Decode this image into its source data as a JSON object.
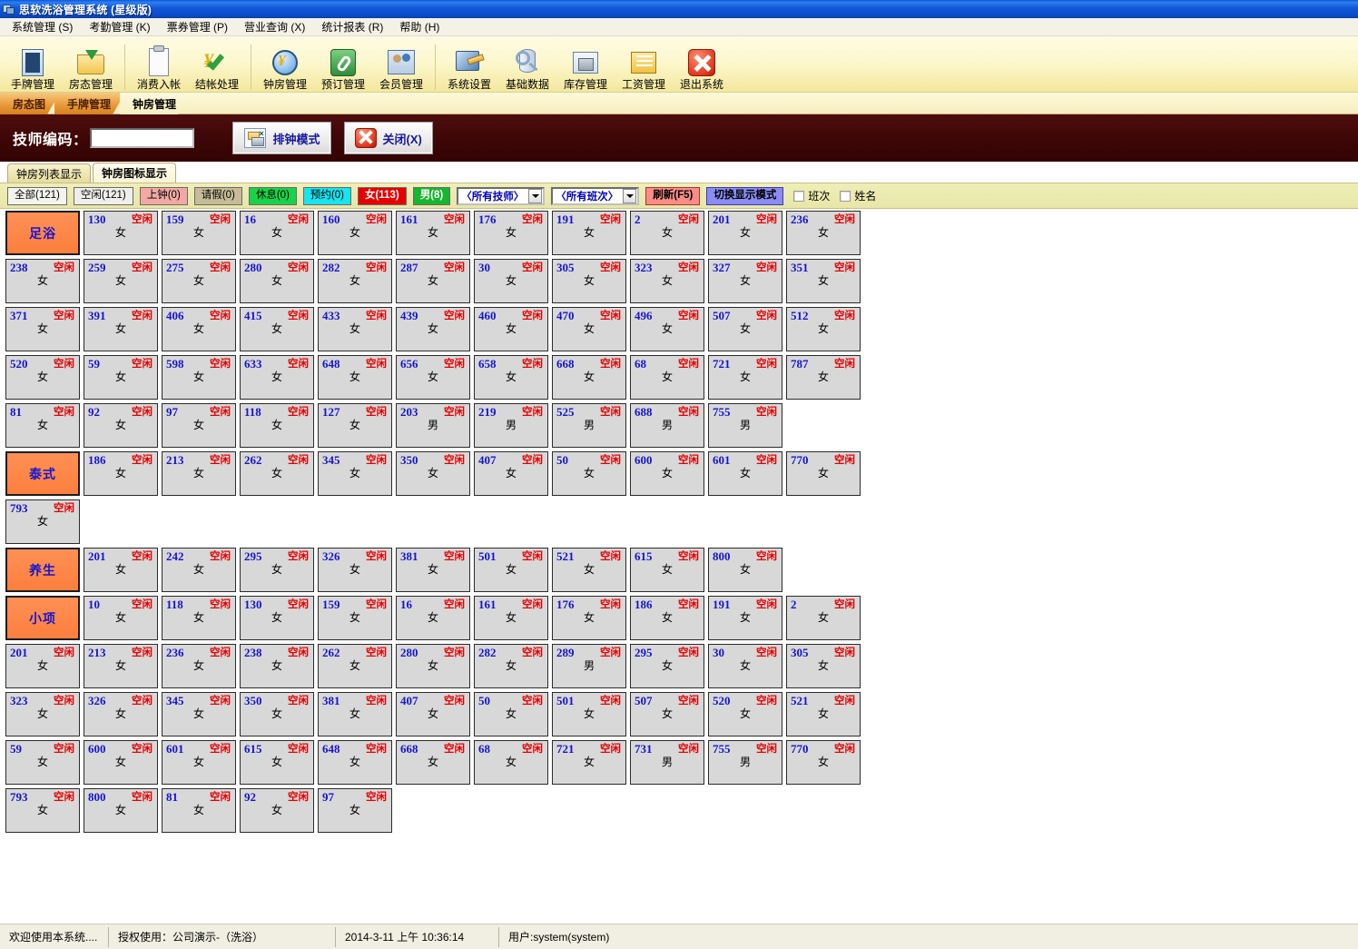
{
  "window": {
    "title": "思软洗浴管理系统 (星级版)"
  },
  "menu": [
    {
      "label": "系统管理 (S)"
    },
    {
      "label": "考勤管理 (K)"
    },
    {
      "label": "票券管理 (P)"
    },
    {
      "label": "营业查询 (X)"
    },
    {
      "label": "统计报表 (R)"
    },
    {
      "label": "帮助 (H)"
    }
  ],
  "toolbar": [
    {
      "label": "手牌管理",
      "icon": "hand-card-icon"
    },
    {
      "label": "房态管理",
      "icon": "room-status-icon"
    },
    {
      "sep": true
    },
    {
      "label": "消费入帐",
      "icon": "consume-entry-icon"
    },
    {
      "label": "结帐处理",
      "icon": "checkout-icon"
    },
    {
      "sep": true
    },
    {
      "label": "钟房管理",
      "icon": "clock-room-icon"
    },
    {
      "label": "预订管理",
      "icon": "reservation-icon"
    },
    {
      "label": "会员管理",
      "icon": "member-icon"
    },
    {
      "sep": true
    },
    {
      "label": "系统设置",
      "icon": "system-settings-icon"
    },
    {
      "label": "基础数据",
      "icon": "base-data-icon"
    },
    {
      "label": "库存管理",
      "icon": "inventory-icon"
    },
    {
      "label": "工资管理",
      "icon": "payroll-icon"
    },
    {
      "label": "退出系统",
      "icon": "exit-icon"
    }
  ],
  "tabs": [
    {
      "label": "房态图",
      "active": false
    },
    {
      "label": "手牌管理",
      "active": false
    },
    {
      "label": "钟房管理",
      "active": true
    }
  ],
  "header": {
    "code_label": "技师编码：",
    "code_value": "",
    "code_placeholder": "",
    "schedule_button": "排钟模式",
    "close_button": "关闭(X)"
  },
  "subtabs": [
    {
      "label": "钟房列表显示",
      "active": false
    },
    {
      "label": "钟房图标显示",
      "active": true
    }
  ],
  "filters": {
    "buttons": [
      {
        "label": "全部(121)",
        "key": "all"
      },
      {
        "label": "空闲(121)",
        "key": "free"
      },
      {
        "label": "上钟(0)",
        "key": "working"
      },
      {
        "label": "请假(0)",
        "key": "leave"
      },
      {
        "label": "休息(0)",
        "key": "rest"
      },
      {
        "label": "预约(0)",
        "key": "booked"
      },
      {
        "label": "女(113)",
        "key": "female"
      },
      {
        "label": "男(8)",
        "key": "male"
      }
    ],
    "select_tech": "〈所有技师〉",
    "select_shift": "〈所有班次〉",
    "refresh_button": "刷新(F5)",
    "mode_button": "切换显示模式",
    "checkbox_shift": "班次",
    "checkbox_name": "姓名",
    "colors": {
      "working": "#f2a9a4",
      "leave": "#c6bc98",
      "rest": "#17d34b",
      "booked": "#16e4f0",
      "female": "#e70000",
      "male": "#17b62f",
      "refresh": "#fa8c86",
      "mode": "#8a8cf4",
      "category": "#fc7f3d"
    }
  },
  "status_free": "空闲",
  "gender_f": "女",
  "gender_m": "男",
  "grid": [
    {
      "cells": [
        {
          "t": "cat",
          "label": "足浴"
        },
        {
          "id": "130",
          "g": "女"
        },
        {
          "id": "159",
          "g": "女"
        },
        {
          "id": "16",
          "g": "女"
        },
        {
          "id": "160",
          "g": "女"
        },
        {
          "id": "161",
          "g": "女"
        },
        {
          "id": "176",
          "g": "女"
        },
        {
          "id": "191",
          "g": "女"
        },
        {
          "id": "2",
          "g": "女"
        },
        {
          "id": "201",
          "g": "女"
        },
        {
          "id": "236",
          "g": "女"
        }
      ]
    },
    {
      "cells": [
        {
          "id": "238",
          "g": "女"
        },
        {
          "id": "259",
          "g": "女"
        },
        {
          "id": "275",
          "g": "女"
        },
        {
          "id": "280",
          "g": "女"
        },
        {
          "id": "282",
          "g": "女"
        },
        {
          "id": "287",
          "g": "女"
        },
        {
          "id": "30",
          "g": "女"
        },
        {
          "id": "305",
          "g": "女"
        },
        {
          "id": "323",
          "g": "女"
        },
        {
          "id": "327",
          "g": "女"
        },
        {
          "id": "351",
          "g": "女"
        }
      ]
    },
    {
      "cells": [
        {
          "id": "371",
          "g": "女"
        },
        {
          "id": "391",
          "g": "女"
        },
        {
          "id": "406",
          "g": "女"
        },
        {
          "id": "415",
          "g": "女"
        },
        {
          "id": "433",
          "g": "女"
        },
        {
          "id": "439",
          "g": "女"
        },
        {
          "id": "460",
          "g": "女"
        },
        {
          "id": "470",
          "g": "女"
        },
        {
          "id": "496",
          "g": "女"
        },
        {
          "id": "507",
          "g": "女"
        },
        {
          "id": "512",
          "g": "女"
        }
      ]
    },
    {
      "cells": [
        {
          "id": "520",
          "g": "女"
        },
        {
          "id": "59",
          "g": "女"
        },
        {
          "id": "598",
          "g": "女"
        },
        {
          "id": "633",
          "g": "女"
        },
        {
          "id": "648",
          "g": "女"
        },
        {
          "id": "656",
          "g": "女"
        },
        {
          "id": "658",
          "g": "女"
        },
        {
          "id": "668",
          "g": "女"
        },
        {
          "id": "68",
          "g": "女"
        },
        {
          "id": "721",
          "g": "女"
        },
        {
          "id": "787",
          "g": "女"
        }
      ]
    },
    {
      "cells": [
        {
          "id": "81",
          "g": "女"
        },
        {
          "id": "92",
          "g": "女"
        },
        {
          "id": "97",
          "g": "女"
        },
        {
          "id": "118",
          "g": "女"
        },
        {
          "id": "127",
          "g": "女"
        },
        {
          "id": "203",
          "g": "男"
        },
        {
          "id": "219",
          "g": "男"
        },
        {
          "id": "525",
          "g": "男"
        },
        {
          "id": "688",
          "g": "男"
        },
        {
          "id": "755",
          "g": "男"
        }
      ]
    },
    {
      "cells": [
        {
          "t": "cat",
          "label": "泰式"
        },
        {
          "id": "186",
          "g": "女"
        },
        {
          "id": "213",
          "g": "女"
        },
        {
          "id": "262",
          "g": "女"
        },
        {
          "id": "345",
          "g": "女"
        },
        {
          "id": "350",
          "g": "女"
        },
        {
          "id": "407",
          "g": "女"
        },
        {
          "id": "50",
          "g": "女"
        },
        {
          "id": "600",
          "g": "女"
        },
        {
          "id": "601",
          "g": "女"
        },
        {
          "id": "770",
          "g": "女"
        }
      ]
    },
    {
      "cells": [
        {
          "id": "793",
          "g": "女"
        }
      ]
    },
    {
      "cells": [
        {
          "t": "cat",
          "label": "养生"
        },
        {
          "id": "201",
          "g": "女"
        },
        {
          "id": "242",
          "g": "女"
        },
        {
          "id": "295",
          "g": "女"
        },
        {
          "id": "326",
          "g": "女"
        },
        {
          "id": "381",
          "g": "女"
        },
        {
          "id": "501",
          "g": "女"
        },
        {
          "id": "521",
          "g": "女"
        },
        {
          "id": "615",
          "g": "女"
        },
        {
          "id": "800",
          "g": "女"
        }
      ]
    },
    {
      "cells": [
        {
          "t": "cat",
          "label": "小项"
        },
        {
          "id": "10",
          "g": "女"
        },
        {
          "id": "118",
          "g": "女"
        },
        {
          "id": "130",
          "g": "女"
        },
        {
          "id": "159",
          "g": "女"
        },
        {
          "id": "16",
          "g": "女"
        },
        {
          "id": "161",
          "g": "女"
        },
        {
          "id": "176",
          "g": "女"
        },
        {
          "id": "186",
          "g": "女"
        },
        {
          "id": "191",
          "g": "女"
        },
        {
          "id": "2",
          "g": "女"
        }
      ]
    },
    {
      "cells": [
        {
          "id": "201",
          "g": "女"
        },
        {
          "id": "213",
          "g": "女"
        },
        {
          "id": "236",
          "g": "女"
        },
        {
          "id": "238",
          "g": "女"
        },
        {
          "id": "262",
          "g": "女"
        },
        {
          "id": "280",
          "g": "女"
        },
        {
          "id": "282",
          "g": "女"
        },
        {
          "id": "289",
          "g": "男"
        },
        {
          "id": "295",
          "g": "女"
        },
        {
          "id": "30",
          "g": "女"
        },
        {
          "id": "305",
          "g": "女"
        }
      ]
    },
    {
      "cells": [
        {
          "id": "323",
          "g": "女"
        },
        {
          "id": "326",
          "g": "女"
        },
        {
          "id": "345",
          "g": "女"
        },
        {
          "id": "350",
          "g": "女"
        },
        {
          "id": "381",
          "g": "女"
        },
        {
          "id": "407",
          "g": "女"
        },
        {
          "id": "50",
          "g": "女"
        },
        {
          "id": "501",
          "g": "女"
        },
        {
          "id": "507",
          "g": "女"
        },
        {
          "id": "520",
          "g": "女"
        },
        {
          "id": "521",
          "g": "女"
        }
      ]
    },
    {
      "cells": [
        {
          "id": "59",
          "g": "女"
        },
        {
          "id": "600",
          "g": "女"
        },
        {
          "id": "601",
          "g": "女"
        },
        {
          "id": "615",
          "g": "女"
        },
        {
          "id": "648",
          "g": "女"
        },
        {
          "id": "668",
          "g": "女"
        },
        {
          "id": "68",
          "g": "女"
        },
        {
          "id": "721",
          "g": "女"
        },
        {
          "id": "731",
          "g": "男"
        },
        {
          "id": "755",
          "g": "男"
        },
        {
          "id": "770",
          "g": "女"
        }
      ]
    },
    {
      "cells": [
        {
          "id": "793",
          "g": "女"
        },
        {
          "id": "800",
          "g": "女"
        },
        {
          "id": "81",
          "g": "女"
        },
        {
          "id": "92",
          "g": "女"
        },
        {
          "id": "97",
          "g": "女"
        }
      ]
    }
  ],
  "statusbar": {
    "welcome": "欢迎使用本系统....",
    "license": "授权使用：公司演示-（洗浴）",
    "datetime": "2014-3-11 上午 10:36:14",
    "user": "用户:system(system)"
  }
}
